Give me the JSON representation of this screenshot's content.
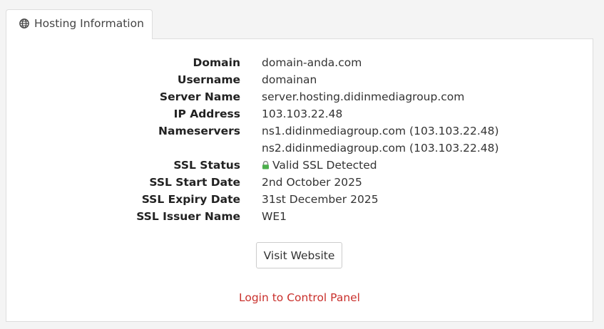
{
  "tab": {
    "label": "Hosting Information",
    "icon": "globe-icon"
  },
  "info": [
    {
      "label": "Domain",
      "value": "domain-anda.com"
    },
    {
      "label": "Username",
      "value": "domainan"
    },
    {
      "label": "Server Name",
      "value": "server.hosting.didinmediagroup.com"
    },
    {
      "label": "IP Address",
      "value": "103.103.22.48"
    },
    {
      "label": "Nameservers",
      "value": "ns1.didinmediagroup.com (103.103.22.48)"
    },
    {
      "label": "",
      "value": "ns2.didinmediagroup.com (103.103.22.48)"
    },
    {
      "label": "SSL Status",
      "value": "Valid SSL Detected",
      "icon": "lock-icon",
      "status_color": "#4cae4c"
    },
    {
      "label": "SSL Start Date",
      "value": "2nd October 2025"
    },
    {
      "label": "SSL Expiry Date",
      "value": "31st December 2025"
    },
    {
      "label": "SSL Issuer Name",
      "value": "WE1"
    }
  ],
  "actions": {
    "visit_label": "Visit Website",
    "login_label": "Login to Control Panel",
    "login_color": "#c9302c"
  }
}
